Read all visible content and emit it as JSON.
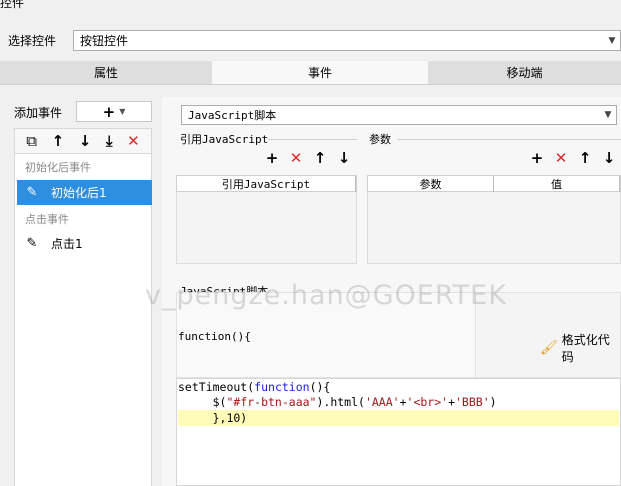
{
  "window": {
    "title": "控件"
  },
  "selector": {
    "label": "选择控件",
    "value": "按钮控件"
  },
  "tabs": [
    {
      "label": "属性"
    },
    {
      "label": "事件"
    },
    {
      "label": "移动端"
    }
  ],
  "left": {
    "add_event_label": "添加事件",
    "add_button": "+",
    "groups": [
      {
        "label": "初始化后事件",
        "items": [
          {
            "label": "初始化后1",
            "selected": true
          }
        ]
      },
      {
        "label": "点击事件",
        "items": [
          {
            "label": "点击1",
            "selected": false
          }
        ]
      }
    ]
  },
  "right": {
    "script_type": "JavaScript脚本",
    "ref_js_title": "引用JavaScript",
    "ref_js_col": "引用JavaScript",
    "params_title": "参数",
    "params_cols": [
      "参数",
      "值"
    ],
    "script_section_title": "JavaScript脚本",
    "function_header": "function(){",
    "format_button": "格式化代码"
  },
  "code": {
    "line1_a": "setTimeout(",
    "line1_kw": "function",
    "line1_b": "(){",
    "line2_a": "     $(",
    "line2_s1": "\"#fr-btn-aaa\"",
    "line2_b": ").html(",
    "line2_s2": "'AAA'",
    "line2_c": "+",
    "line2_s3": "'<br>'",
    "line2_d": "+",
    "line2_s4": "'BBB'",
    "line2_e": ")",
    "line3": "     },10)"
  },
  "watermark": "v_pengze.han@GOERTEK",
  "colors": {
    "selected_bg": "#2e8ee0",
    "delete_red": "#e0282b",
    "highlight": "#fffbb8"
  }
}
